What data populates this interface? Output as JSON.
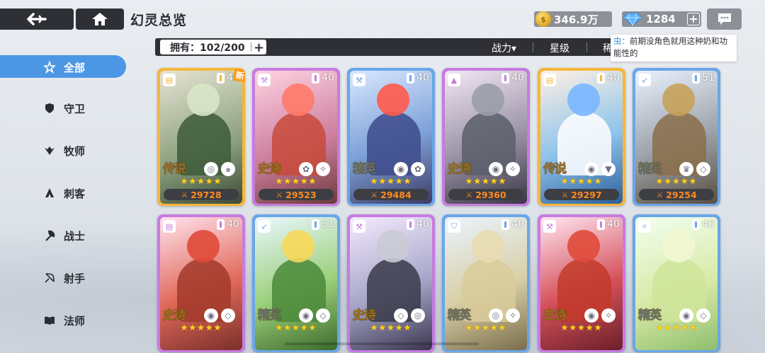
{
  "header": {
    "title": "幻灵总览",
    "gold": "346.9万",
    "gems": "1284",
    "gem_plus": "+"
  },
  "filter": {
    "owned": "拥有：102/200",
    "sorts": [
      {
        "label": "战力▾"
      },
      {
        "label": "星级"
      },
      {
        "label": "稀"
      }
    ]
  },
  "tooltip": {
    "who": "虫：",
    "text": "前期没角色就用这种奶和功能性的"
  },
  "sidebar": {
    "items": [
      {
        "label": "全部",
        "icon": "all-star-icon",
        "selected": true
      },
      {
        "label": "守卫",
        "icon": "shield-icon"
      },
      {
        "label": "牧师",
        "icon": "wings-icon"
      },
      {
        "label": "刺客",
        "icon": "assassin-icon"
      },
      {
        "label": "战士",
        "icon": "axe-icon"
      },
      {
        "label": "射手",
        "icon": "bow-icon"
      },
      {
        "label": "法师",
        "icon": "book-icon"
      }
    ]
  },
  "colors": {
    "sidebar_selected": "#4c97e4",
    "legend": "#f6b63a",
    "epic": "#c77be0",
    "elite": "#6aa6e8",
    "power": "#ff8a1f"
  },
  "cards": [
    {
      "rank": "传说",
      "level": "40",
      "power": "29728",
      "stars": "★★★★★",
      "is_new": true,
      "new_label": "新",
      "class_icon": "book-icon",
      "runes": [
        "water-rune-icon",
        "wind-rune-icon"
      ]
    },
    {
      "rank": "史诗",
      "level": "40",
      "power": "29523",
      "stars": "★★★★★",
      "class_icon": "axe-icon",
      "runes": [
        "leaf-rune-icon",
        "sparkle-rune-icon"
      ]
    },
    {
      "rank": "精英",
      "level": "40",
      "power": "29484",
      "stars": "★★★★★",
      "class_icon": "axe-icon",
      "runes": [
        "fire-rune-icon",
        "leaf-rune-icon"
      ]
    },
    {
      "rank": "史诗",
      "level": "40",
      "power": "29360",
      "stars": "★★★★★",
      "class_icon": "assassin-icon",
      "runes": [
        "fire-rune-icon",
        "sparkle-rune-icon"
      ]
    },
    {
      "rank": "传说",
      "level": "40",
      "power": "29297",
      "stars": "★★★★★",
      "class_icon": "book-icon",
      "runes": [
        "fire-rune-icon",
        "wings-rune-icon"
      ]
    },
    {
      "rank": "精英",
      "level": "51",
      "power": "29254",
      "stars": "★★★★★",
      "class_icon": "bow-icon",
      "runes": [
        "crown-rune-icon",
        "diamond-rune-icon"
      ]
    },
    {
      "rank": "史诗",
      "level": "40",
      "power": "",
      "stars": "★★★★★",
      "class_icon": "book-icon",
      "runes": [
        "fire-rune-icon",
        "diamond-rune-icon"
      ]
    },
    {
      "rank": "精英",
      "level": "51",
      "power": "",
      "stars": "★★★★★",
      "class_icon": "bow-icon",
      "runes": [
        "fire-rune-icon",
        "diamond-rune-icon"
      ]
    },
    {
      "rank": "史诗",
      "level": "40",
      "power": "",
      "stars": "★★★★★",
      "class_icon": "axe-icon",
      "runes": [
        "diamond-rune-icon",
        "water-rune-icon"
      ]
    },
    {
      "rank": "精英",
      "level": "40",
      "power": "",
      "stars": "★★★★★",
      "class_icon": "shield-icon",
      "runes": [
        "water-rune-icon",
        "sparkle-rune-icon"
      ]
    },
    {
      "rank": "史诗",
      "level": "40",
      "power": "",
      "stars": "★★★★★",
      "class_icon": "axe-icon",
      "runes": [
        "fire-rune-icon",
        "sparkle-rune-icon"
      ]
    },
    {
      "rank": "精英",
      "level": "40",
      "power": "",
      "stars": "★★★★★",
      "class_icon": "wings-icon",
      "runes": [
        "fire-rune-icon",
        "diamond-rune-icon"
      ]
    }
  ]
}
